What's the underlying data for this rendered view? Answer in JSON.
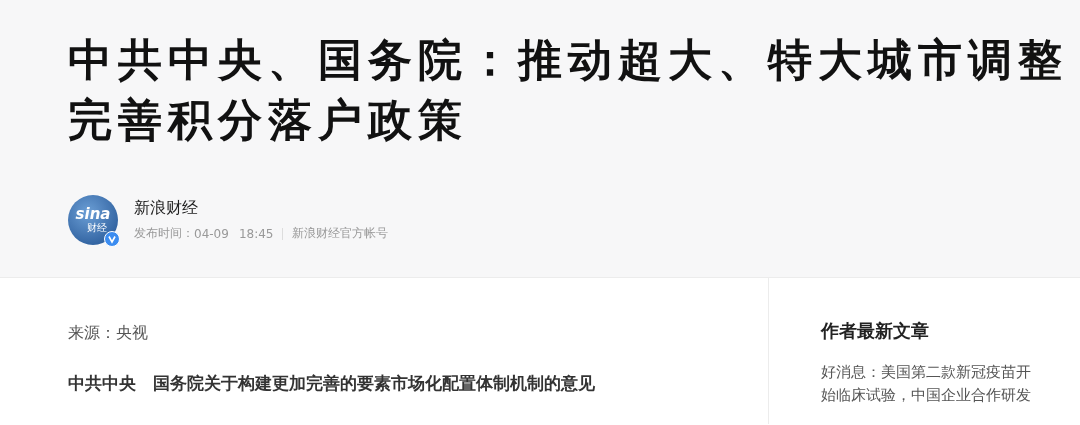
{
  "article": {
    "title": "中共中央、国务院：推动超大、特大城市调整完善积分落户政策",
    "author": {
      "avatar": {
        "logo_text": "sina",
        "sub_text": "财经",
        "verified": true
      },
      "name": "新浪财经",
      "publish_label": "发布时间：",
      "date": "04-09",
      "time": "18:45",
      "account": "新浪财经官方帐号"
    }
  },
  "body": {
    "source": "来源：央视",
    "heading": "中共中央　国务院关于构建更加完善的要素市场化配置体制机制的意见"
  },
  "sidebar": {
    "title": "作者最新文章",
    "articles": [
      {
        "title": "好消息：美国第二款新冠疫苗开始临床试验，中国企业合作研发"
      }
    ]
  }
}
